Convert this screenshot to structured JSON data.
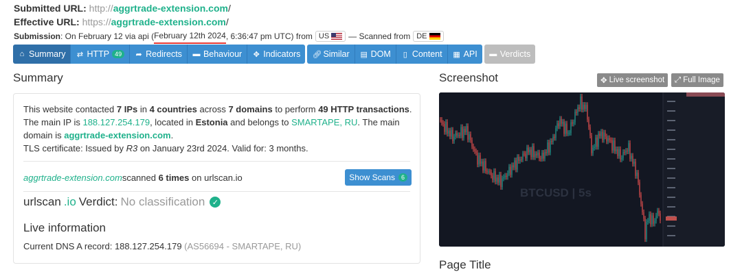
{
  "header": {
    "submitted_label": "Submitted URL:",
    "submitted_scheme": "http://",
    "submitted_domain": "aggrtrade-extension.com",
    "submitted_tail": "/",
    "effective_label": "Effective URL:",
    "effective_scheme": "https://",
    "effective_domain": "aggrtrade-extension.com",
    "effective_tail": "/",
    "submission_label": "Submission",
    "submission_text": ": On February 12 via api",
    "date_open": "(",
    "date_highlight": "February 12th 2024",
    "date_rest": ", 6:36:47 pm UTC) from",
    "from_country": "US",
    "scanned_text": "— Scanned from",
    "scanned_country": "DE"
  },
  "nav": {
    "summary": "Summary",
    "http": "HTTP",
    "http_count": "49",
    "redirects": "Redirects",
    "behaviour": "Behaviour",
    "indicators": "Indicators",
    "similar": "Similar",
    "dom": "DOM",
    "content": "Content",
    "api": "API",
    "verdicts": "Verdicts"
  },
  "summary": {
    "title": "Summary",
    "s1": "This website contacted ",
    "ips": "7 IPs",
    "s2": " in ",
    "countries": "4 countries",
    "s3": " across ",
    "domains": "7 domains",
    "s4": " to perform ",
    "transactions": "49 HTTP transactions",
    "s5": ".",
    "s6": "The main IP is ",
    "main_ip": "188.127.254.179",
    "s7": ", located in ",
    "country": "Estonia",
    "s8": " and belongs to ",
    "asn": "SMARTAPE, RU",
    "s9": ". The main",
    "s10": "domain is ",
    "main_domain": "aggrtrade-extension.com",
    "s11": ".",
    "tls_a": "TLS certificate: Issued by ",
    "tls_issuer": "R3",
    "tls_b": " on January 23rd 2024. Valid for: 3 months.",
    "scan_domain": "aggrtrade-extension.com",
    "scan_a": " scanned ",
    "scan_times": "6 times",
    "scan_b": " on urlscan.io",
    "show_scans": "Show Scans",
    "show_scans_count": "6",
    "verdict_brand_a": "urlscan",
    "verdict_brand_b": ".io",
    "verdict_word": " Verdict: ",
    "verdict_value": "No classification",
    "live_title": "Live information",
    "dns_label": "Current DNS A record: ",
    "dns_ip": "188.127.254.179",
    "dns_asn": " (AS56694 - SMARTAPE, RU)"
  },
  "screenshot": {
    "title": "Screenshot",
    "live_btn": "Live screenshot",
    "full_btn": "Full Image",
    "watermark": "BTCUSD | 5s"
  },
  "page_title": {
    "title": "Page Title"
  },
  "colors": {
    "accent": "#3d8fd1",
    "green": "#1fb18b",
    "underline": "#e53935",
    "candle_up": "#26a69a",
    "candle_down": "#ef5350"
  }
}
